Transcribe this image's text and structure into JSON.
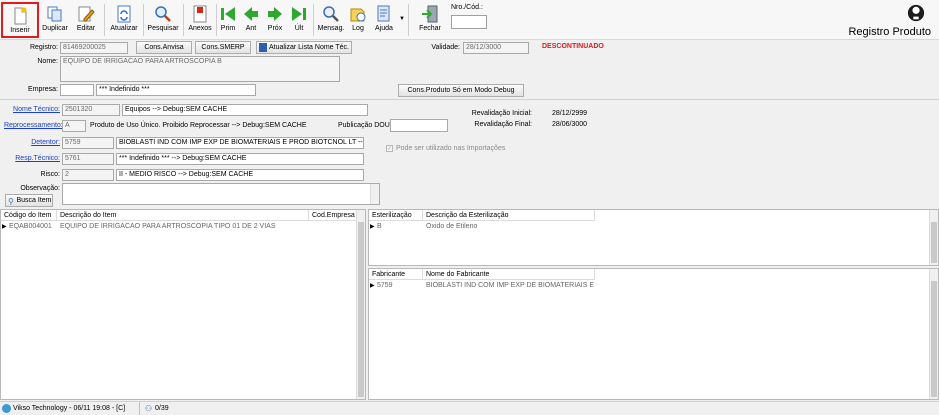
{
  "toolbar": {
    "inserir": "Inserir",
    "duplicar": "Duplicar",
    "editar": "Editar",
    "atualizar": "Atualizar",
    "pesquisar": "Pesquisar",
    "anexos": "Anexos",
    "prim": "Prim",
    "ant": "Ant",
    "prox": "Próx",
    "ult": "Últ",
    "mensag": "Mensag.",
    "log": "Log",
    "ajuda": "Ajuda",
    "fechar": "Fechar",
    "nro_label": "Nro./Cód.:",
    "nro_value": ""
  },
  "header": {
    "title": "Registro Produto"
  },
  "form": {
    "registro_label": "Registro:",
    "registro_value": "81469200025",
    "cons_anvisa": "Cons.Anvisa",
    "cons_smerp": "Cons.SMERP",
    "atualizar_lista": "Atualizar Lista Nome Téc.",
    "validade_label": "Validade:",
    "validade_value": "28/12/3000",
    "status": "DESCONTINUADO",
    "nome_label": "Nome:",
    "nome_value": "EQUIPO DE IRRIGACAO PARA ARTROSCOPIA B",
    "empresa_label": "Empresa:",
    "empresa_code": "",
    "empresa_value": "*** Indefinido ***",
    "cons_produto": "Cons.Produto Só em Modo Debug",
    "nome_tecnico_label": "Nome Técnico:",
    "nome_tecnico_code": "2501320",
    "nome_tecnico_value": "Equipos  --> Debug:SEM CACHE",
    "reprocessamento_label": "Reprocessamento:",
    "reprocessamento_code": "A",
    "reprocessamento_value": "Produto de Uso Único. Proibido Reprocessar  --> Debug:SEM CACHE",
    "publicacao_label": "Publicação DOU:",
    "publicacao_value": "",
    "revalidacao_inicial_label": "Revalidação Inicial:",
    "revalidacao_inicial_value": "28/12/2999",
    "revalidacao_final_label": "Revalidação Final:",
    "revalidacao_final_value": "28/06/3000",
    "detentor_label": "Detentor:",
    "detentor_code": "5759",
    "detentor_value": "BIOBLASTI IND COM IMP EXP DE BIOMATERIAIS E PROD BIOTCNOL LT  --> Debu",
    "resp_tecnico_label": "Resp.Técnico:",
    "resp_tecnico_code": "5761",
    "resp_tecnico_value": "*** Indefinido ***  --> Debug:SEM CACHE",
    "importacoes_label": "Pode ser utilizado nas Importações",
    "risco_label": "Risco:",
    "risco_code": "2",
    "risco_value": "II - MEDIO RISCO  --> Debug:SEM CACHE",
    "observacao_label": "Observação:",
    "observacao_value": "",
    "busca_item": "Busca Item"
  },
  "items_grid": {
    "headers": [
      "Código do Item",
      "Descrição do Item",
      "Cod.Empresa"
    ],
    "rows": [
      {
        "codigo": "EQAB004001",
        "descricao": "EQUIPO DE IRRIGACAO PARA ARTROSCOPIA TIPO 01 DE 2 VIAS",
        "empresa": ""
      }
    ]
  },
  "ester_grid": {
    "headers": [
      "Esterilização",
      "Descrição da Esterilização"
    ],
    "rows": [
      {
        "codigo": "B",
        "descricao": "Óxido de Etileno"
      }
    ]
  },
  "fab_grid": {
    "headers": [
      "Fabricante",
      "Nome do Fabricante"
    ],
    "rows": [
      {
        "codigo": "5759",
        "nome": "BIOBLASTI IND COM IMP EXP DE BIOMATERIAIS E PROD"
      }
    ]
  },
  "status": {
    "company": "Vikso Technology - 06/11 19:08 - [C]",
    "users": "0/39"
  },
  "colors": {
    "link": "#1a3fd1",
    "alert": "#e01a1a",
    "highlight": "#e21c1c"
  }
}
